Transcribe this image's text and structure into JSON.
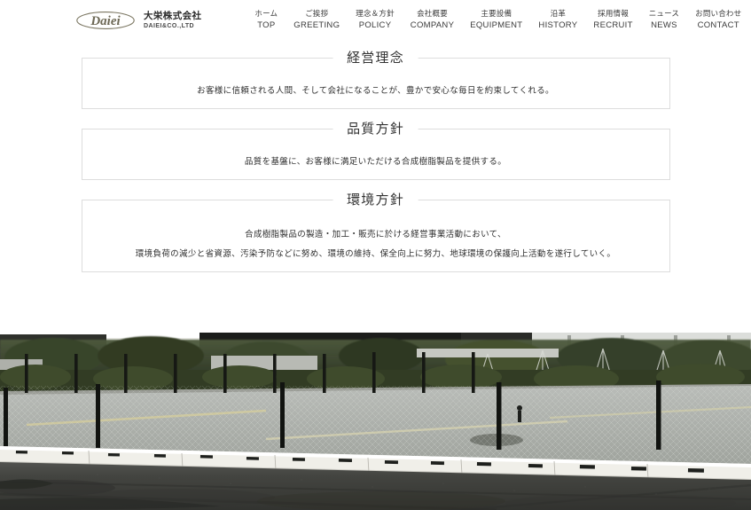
{
  "header": {
    "logo": {
      "icon": "daiei-ellipse-logo",
      "wordmark": "Daiei",
      "color": "#7a7560"
    },
    "company_name_jp": "大栄株式会社",
    "company_name_en": "DAIEI&CO.,LTD"
  },
  "nav": {
    "items": [
      {
        "jp": "ホーム",
        "en": "TOP"
      },
      {
        "jp": "ご挨拶",
        "en": "GREETING"
      },
      {
        "jp": "理念＆方針",
        "en": "POLICY"
      },
      {
        "jp": "会社概要",
        "en": "COMPANY"
      },
      {
        "jp": "主要設備",
        "en": "EQUIPMENT"
      },
      {
        "jp": "沿革",
        "en": "HISTORY"
      },
      {
        "jp": "採用情報",
        "en": "RECRUIT"
      },
      {
        "jp": "ニュース",
        "en": "NEWS"
      },
      {
        "jp": "お問い合わせ",
        "en": "CONTACT"
      }
    ]
  },
  "sections": [
    {
      "title": "経営理念",
      "lines": [
        "お客様に信頼される人間、そして会社になることが、豊かで安心な毎日を約束してくれる。"
      ]
    },
    {
      "title": "品質方針",
      "lines": [
        "品質を基盤に、お客様に満足いただける合成樹脂製品を提供する。"
      ]
    },
    {
      "title": "環境方針",
      "lines": [
        "合成樹脂製品の製造・加工・販売に於ける経営事業活動において、",
        "環境負荷の減少と省資源、汚染予防などに努め、環境の維持、保全向上に努力、地球環境の保護向上活動を遂行していく。"
      ]
    }
  ],
  "hero": {
    "name": "factory-parking-lot-photo",
    "description": "Asphalt parking lot with white concrete curb, black bollard fence, hedges and building beyond"
  },
  "colors": {
    "text": "#333333",
    "border": "#dddddd",
    "logo": "#7a7560",
    "asphalt": "#3a3b3a"
  }
}
